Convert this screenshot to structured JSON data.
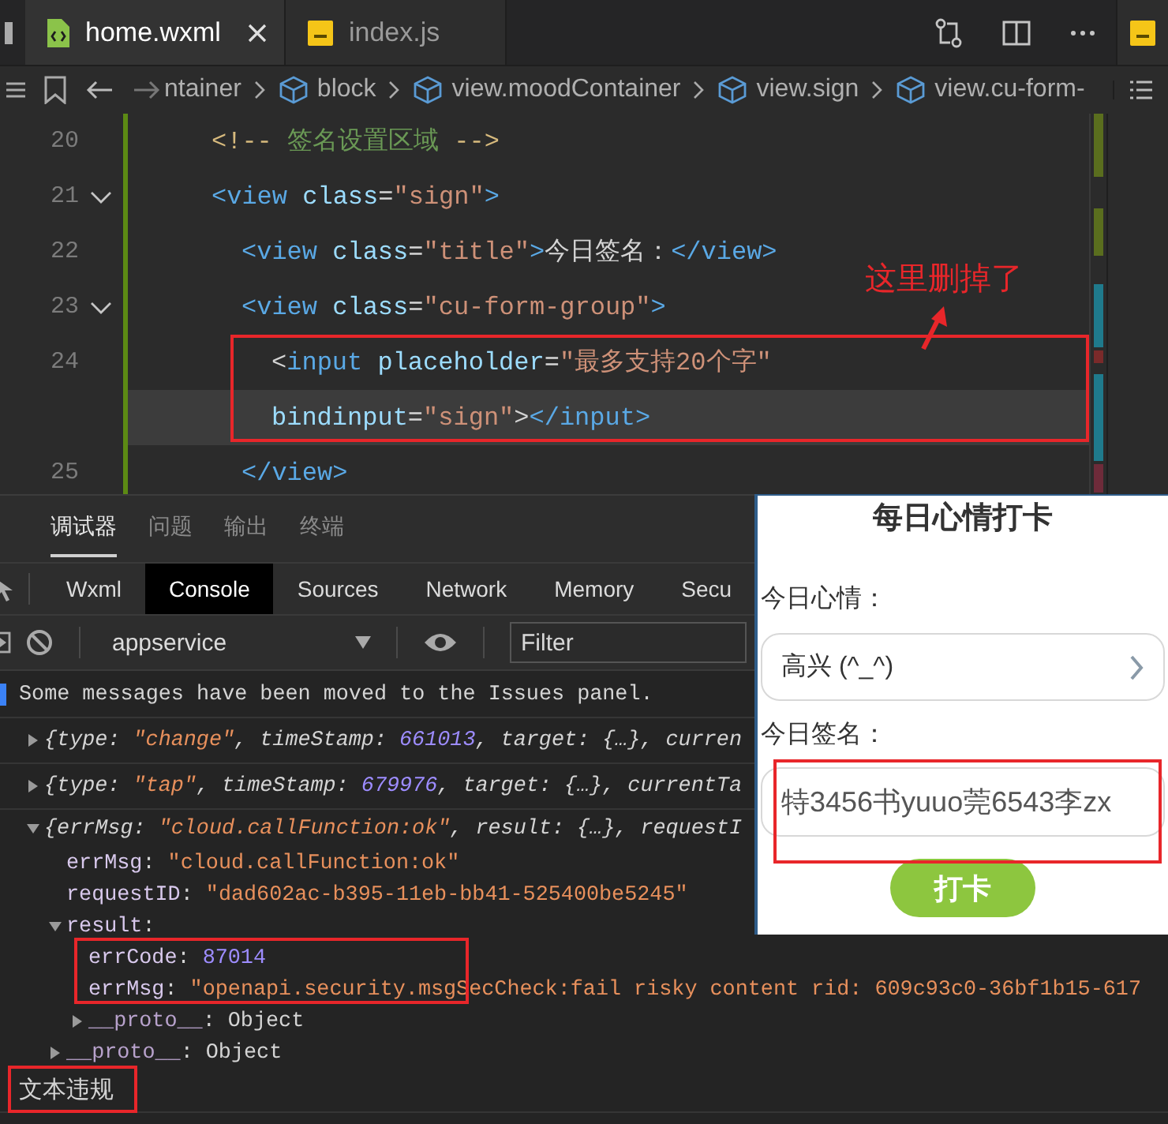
{
  "editor_tabs": [
    {
      "label": "home.wxml",
      "kind": "code",
      "selected": true,
      "closable": true
    },
    {
      "label": "index.js",
      "kind": "js",
      "selected": false,
      "closable": false
    }
  ],
  "breadcrumb": [
    {
      "text": "ntainer",
      "icon": false
    },
    {
      "text": "block",
      "icon": true
    },
    {
      "text": "view.moodContainer",
      "icon": true
    },
    {
      "text": "view.sign",
      "icon": true
    },
    {
      "text": "view.cu-form-",
      "icon": true
    }
  ],
  "code_lines": [
    {
      "number": "20",
      "foldable": false,
      "rows": [
        {
          "highlighted": false,
          "tokens": [
            {
              "kind": "comment-delim",
              "text": "<!--"
            },
            {
              "kind": "comment",
              "text": " 签名设置区域 "
            },
            {
              "kind": "comment-delim",
              "text": "-->"
            }
          ]
        }
      ]
    },
    {
      "number": "21",
      "foldable": true,
      "rows": [
        {
          "highlighted": false,
          "tokens": [
            {
              "kind": "tag",
              "text": "<view"
            },
            {
              "kind": "attr",
              "text": " class"
            },
            {
              "kind": "punct",
              "text": "="
            },
            {
              "kind": "string",
              "text": "\"sign\""
            },
            {
              "kind": "tag",
              "text": ">"
            }
          ]
        }
      ],
      "children": [
        {
          "number": "22",
          "foldable": false,
          "rows": [
            {
              "highlighted": false,
              "tokens": [
                {
                  "kind": "tag",
                  "text": "<view"
                },
                {
                  "kind": "attr",
                  "text": " class"
                },
                {
                  "kind": "punct",
                  "text": "="
                },
                {
                  "kind": "string",
                  "text": "\"title\""
                },
                {
                  "kind": "tag",
                  "text": ">"
                },
                {
                  "kind": "text",
                  "text": "今日签名："
                },
                {
                  "kind": "tag",
                  "text": "</view>"
                }
              ]
            }
          ]
        },
        {
          "number": "23",
          "foldable": true,
          "rows": [
            {
              "highlighted": false,
              "tokens": [
                {
                  "kind": "tag",
                  "text": "<view"
                },
                {
                  "kind": "attr",
                  "text": " class"
                },
                {
                  "kind": "punct",
                  "text": "="
                },
                {
                  "kind": "string",
                  "text": "\"cu-form-group\""
                },
                {
                  "kind": "tag",
                  "text": ">"
                }
              ]
            }
          ],
          "children": [
            {
              "number": "24",
              "foldable": false,
              "rows": [
                {
                  "highlighted": false,
                  "tokens": [
                    {
                      "kind": "punct",
                      "text": "<"
                    },
                    {
                      "kind": "tag",
                      "text": "input"
                    },
                    {
                      "kind": "attr",
                      "text": " placeholder"
                    },
                    {
                      "kind": "punct",
                      "text": "="
                    },
                    {
                      "kind": "string",
                      "text": "\"最多支持20个字\""
                    }
                  ]
                },
                {
                  "highlighted": true,
                  "tokens": [
                    {
                      "kind": "attr",
                      "text": "bindinput"
                    },
                    {
                      "kind": "punct",
                      "text": "="
                    },
                    {
                      "kind": "string",
                      "text": "\"sign\""
                    },
                    {
                      "kind": "punct",
                      "text": ">"
                    },
                    {
                      "kind": "tag",
                      "text": "</input>"
                    }
                  ]
                }
              ]
            }
          ]
        },
        {
          "number": "25",
          "foldable": false,
          "rows": [
            {
              "highlighted": false,
              "tokens": [
                {
                  "kind": "tag",
                  "text": "</view>"
                }
              ]
            }
          ]
        }
      ]
    }
  ],
  "annotation": "这里删掉了",
  "devtools": {
    "panel_tabs": [
      {
        "label": "调试器",
        "selected": true
      },
      {
        "label": "问题",
        "selected": false
      },
      {
        "label": "输出",
        "selected": false
      },
      {
        "label": "终端",
        "selected": false
      }
    ],
    "tool_tabs": [
      {
        "label": "Wxml",
        "selected": false
      },
      {
        "label": "Console",
        "selected": true
      },
      {
        "label": "Sources",
        "selected": false
      },
      {
        "label": "Network",
        "selected": false
      },
      {
        "label": "Memory",
        "selected": false
      },
      {
        "label": "Secu",
        "selected": false
      }
    ],
    "context": "appservice",
    "filter": {
      "placeholder": "Filter"
    }
  },
  "console": [
    {
      "kind": "info",
      "tokens": [
        {
          "kind": "plain",
          "text": "Some messages have been moved to the Issues panel."
        }
      ]
    },
    {
      "kind": "object",
      "expanded": false,
      "tokens": [
        {
          "kind": "plain",
          "text": "{type: "
        },
        {
          "kind": "string",
          "text": "\"change\""
        },
        {
          "kind": "plain",
          "text": ", timeStamp: "
        },
        {
          "kind": "number",
          "text": "661013"
        },
        {
          "kind": "plain",
          "text": ", target: {…}, curren"
        }
      ]
    },
    {
      "kind": "object",
      "expanded": false,
      "tokens": [
        {
          "kind": "plain",
          "text": "{type: "
        },
        {
          "kind": "string",
          "text": "\"tap\""
        },
        {
          "kind": "plain",
          "text": ", timeStamp: "
        },
        {
          "kind": "number",
          "text": "679976"
        },
        {
          "kind": "plain",
          "text": ", target: {…}, currentTa"
        }
      ]
    },
    {
      "kind": "object",
      "expanded": true,
      "tokens": [
        {
          "kind": "plain",
          "text": "{errMsg: "
        },
        {
          "kind": "string",
          "text": "\"cloud.callFunction:ok\""
        },
        {
          "kind": "plain",
          "text": ", result: {…}, requestI"
        }
      ],
      "children": [
        {
          "kind": "property",
          "tokens": [
            {
              "kind": "key",
              "text": "errMsg"
            },
            {
              "kind": "plain",
              "text": ": "
            },
            {
              "kind": "string",
              "text": "\"cloud.callFunction:ok\""
            }
          ]
        },
        {
          "kind": "property",
          "tokens": [
            {
              "kind": "key",
              "text": "requestID"
            },
            {
              "kind": "plain",
              "text": ": "
            },
            {
              "kind": "string",
              "text": "\"dad602ac-b395-11eb-bb41-525400be5245\""
            }
          ]
        },
        {
          "kind": "object",
          "expanded": true,
          "tokens": [
            {
              "kind": "key",
              "text": "result"
            },
            {
              "kind": "plain",
              "text": ":"
            }
          ],
          "children": [
            {
              "kind": "property",
              "tokens": [
                {
                  "kind": "key",
                  "text": "errCode"
                },
                {
                  "kind": "plain",
                  "text": ": "
                },
                {
                  "kind": "number",
                  "text": "87014"
                }
              ]
            },
            {
              "kind": "property",
              "tokens": [
                {
                  "kind": "key",
                  "text": "errMsg"
                },
                {
                  "kind": "plain",
                  "text": ": "
                },
                {
                  "kind": "string",
                  "text": "\"openapi.security.msgSecCheck:fail risky content rid: 609c93c0-36bf1b15-617"
                }
              ]
            },
            {
              "kind": "object",
              "expanded": false,
              "tokens": [
                {
                  "kind": "dim-key",
                  "text": "__proto__"
                },
                {
                  "kind": "plain",
                  "text": ": Object"
                }
              ]
            }
          ]
        },
        {
          "kind": "object",
          "expanded": false,
          "tokens": [
            {
              "kind": "dim-key",
              "text": "__proto__"
            },
            {
              "kind": "plain",
              "text": ": Object"
            }
          ]
        }
      ]
    },
    {
      "kind": "log",
      "tokens": [
        {
          "kind": "plain",
          "text": "文本违规"
        }
      ]
    }
  ],
  "phone": {
    "title": "每日心情打卡",
    "mood_label": "今日心情：",
    "mood_value": "高兴 (^_^)",
    "sign_label": "今日签名：",
    "sign_value": "特3456书yuuo莞6543李zx",
    "submit": "打卡"
  }
}
